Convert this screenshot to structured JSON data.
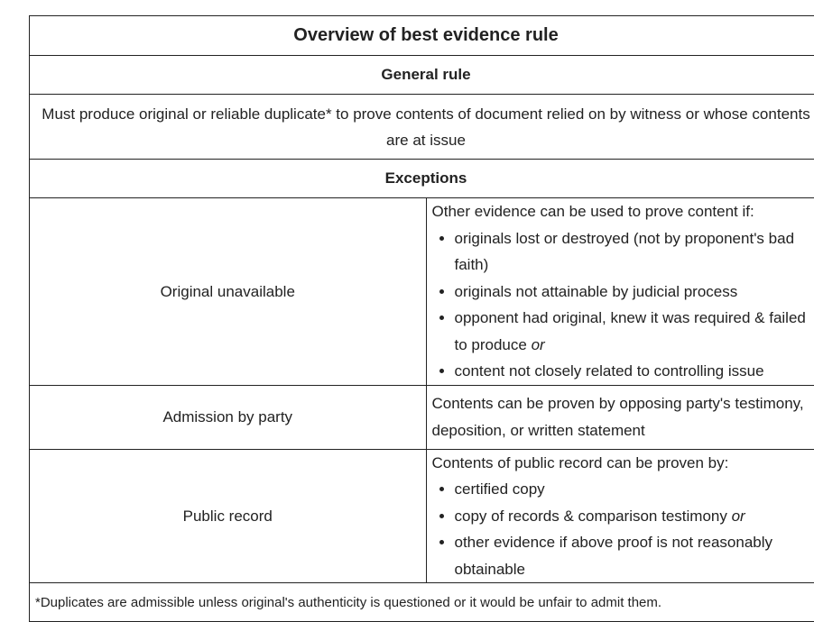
{
  "title": "Overview of best evidence rule",
  "general_rule": {
    "header": "General rule",
    "text": "Must produce original or reliable duplicate* to prove contents of document relied on by witness or whose contents are at issue"
  },
  "exceptions": {
    "header": "Exceptions",
    "rows": [
      {
        "label": "Original unavailable",
        "intro": "Other evidence can be used to prove content if:",
        "items": [
          "originals lost or destroyed (not by proponent's bad faith)",
          "originals not attainable by judicial process",
          "opponent had original, knew it was required & failed to produce",
          "content not closely related to controlling issue"
        ],
        "italic_suffix": "or"
      },
      {
        "label": "Admission by party",
        "text": "Contents can be proven by opposing party's testimony, deposition, or written statement"
      },
      {
        "label": "Public record",
        "intro": "Contents of public record can be proven by:",
        "items": [
          "certified copy",
          "copy of records & comparison testimony",
          "other evidence if above proof is not reasonably obtainable"
        ],
        "italic_suffix": "or"
      }
    ]
  },
  "footnote": "*Duplicates are admissible unless original's authenticity is questioned or it would be unfair to admit them."
}
